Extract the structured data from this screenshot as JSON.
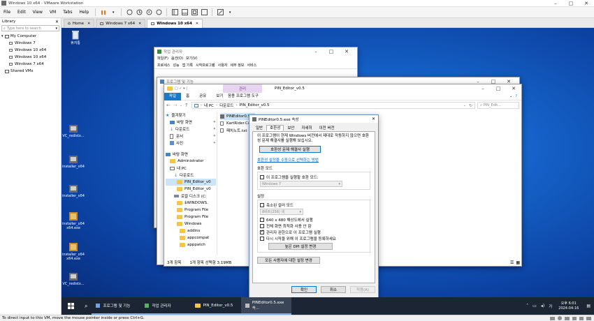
{
  "vmware": {
    "window_title": "Windows 10 x64 - VMware Workstation",
    "menu": [
      "File",
      "Edit",
      "View",
      "VM",
      "Tabs",
      "Help"
    ],
    "library": {
      "title": "Library",
      "search_placeholder": "Type here to search",
      "tree": [
        "My Computer",
        "Windows 7",
        "Windows 10 x64",
        "Windows 10 x64",
        "Windows 7 x64",
        "Shared VMs"
      ]
    },
    "tabs": [
      "Home",
      "Windows 7 x64",
      "Windows 10 x64"
    ],
    "status": "To direct input to this VM, move the mouse pointer inside or press Ctrl+G."
  },
  "desktop": {
    "icons": [
      "휴지통",
      "VC_redistx...",
      "installer_x64",
      "installer_x64",
      "installer_x64 x64.exe",
      "installer_x64 x64.exe",
      "VC_redistx..."
    ]
  },
  "taskmgr": {
    "title": "작업 관리자",
    "menu": [
      "파일(F)",
      "옵션(O)",
      "보기(V)"
    ],
    "tabs": [
      "프로세스",
      "성능",
      "앱 기록",
      "시작프로그램",
      "사용자",
      "세부 정보",
      "서비스"
    ]
  },
  "programs": {
    "title": "프로그램 및 기능"
  },
  "explorer": {
    "title": "PIN_Editor_v0.5",
    "context_tab": "관리",
    "context_subtab": "응용 프로그램 도구",
    "ribbon": [
      "파일",
      "홈",
      "공유",
      "보기"
    ],
    "path": [
      "내 PC",
      "다운로드",
      "PIN_Editor_v0.5"
    ],
    "search_placeholder": "PIN_Edit...",
    "nav": [
      "즐겨찾기",
      "바탕 화면",
      "다운로드",
      "문서",
      "사진",
      "바탕 화면",
      "Administrator",
      "내 PC",
      "다운로드",
      "PIN_Editor_v0",
      "PIN_Editor_v0",
      "로컬 디스크 (C:",
      "$WINDOWS.",
      "Program File",
      "Program File",
      "Windows",
      "addins",
      "appcompat",
      "apppatch"
    ],
    "files": [
      "PINEditor0.5",
      "KartRider.Com",
      "패치노트.txt"
    ],
    "status_left": "3개 항목",
    "status_right": "1개 항목 선택함 3.19MB"
  },
  "props": {
    "title": "PINEditor0.5.exe 속성",
    "tabs": [
      "일반",
      "호환성",
      "보안",
      "자세히",
      "이전 버전"
    ],
    "intro": "이 프로그램이 현재 Windows 버전에서 제대로 작동하지 않으면 호환성 문제 해결사를 실행해 보십시오.",
    "run_troubleshooter": "호환성 문제 해결사 실행",
    "manual_link": "호환성 설정을 수동으로 선택하는 방법",
    "compat_mode_label": "호환 모드",
    "compat_mode_check": "이 프로그램을 실행할 호환 모드:",
    "compat_os": "Windows 7",
    "settings_label": "설정",
    "reduced_color": "축소된 컬러 모드",
    "color_combo": "8비트(256) 색",
    "opt_640": "640 x 480 해상도에서 실행",
    "opt_fullscreen": "전체 화면 최적화 사용 안 함",
    "opt_admin": "관리자 권한으로 이 프로그램 실행",
    "opt_restart": "다시 시작을 위해 이 프로그램을 등록하세요",
    "dpi_button": "높은 DPI 설정 변경",
    "all_users_button": "모든 사용자에 대한 설정 변경",
    "ok": "확인",
    "cancel": "취소",
    "apply": "적용(A)"
  },
  "taskbar": {
    "items": [
      "프로그램 및 기능",
      "작업 관리자",
      "PIN_Editor_v0.5",
      "PINEditor0.5.exe 속..."
    ],
    "time": "오후 6:01",
    "date": "2024-04-16",
    "lang": "가"
  }
}
